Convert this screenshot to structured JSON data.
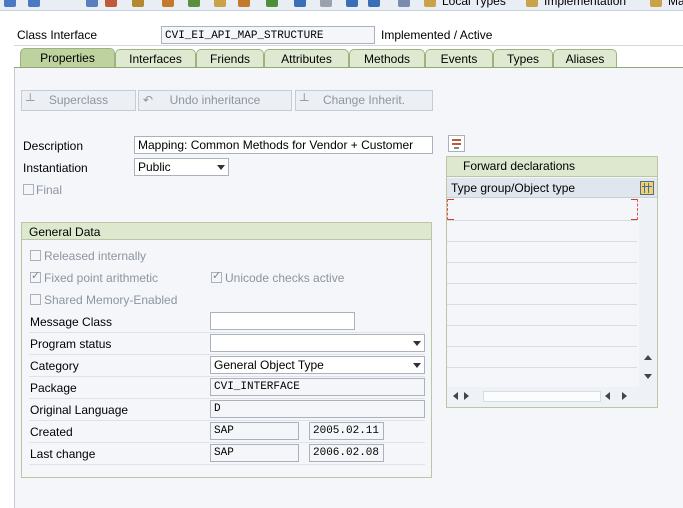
{
  "toolbar": {
    "local_types_label": "Local Types",
    "implementation_label": "Implementation",
    "macros_label": "Ma"
  },
  "header": {
    "class_interface_label": "Class Interface",
    "class_interface_value": "CVI_EI_API_MAP_STRUCTURE",
    "status": "Implemented / Active"
  },
  "tabs": [
    {
      "label": "Properties",
      "active": true
    },
    {
      "label": "Interfaces"
    },
    {
      "label": "Friends"
    },
    {
      "label": "Attributes"
    },
    {
      "label": "Methods"
    },
    {
      "label": "Events"
    },
    {
      "label": "Types"
    },
    {
      "label": "Aliases"
    }
  ],
  "buttons": {
    "superclass": "Superclass",
    "undo_inheritance": "Undo inheritance",
    "change_inherit": "Change Inherit."
  },
  "properties": {
    "description_label": "Description",
    "description_value": "Mapping: Common Methods for Vendor + Customer",
    "instantiation_label": "Instantiation",
    "instantiation_value": "Public",
    "final_label": "Final"
  },
  "general_data": {
    "title": "General Data",
    "released_internally": "Released internally",
    "fixed_point": "Fixed point arithmetic",
    "unicode_checks": "Unicode checks active",
    "shared_memory": "Shared Memory-Enabled",
    "message_class_label": "Message Class",
    "message_class_value": "",
    "program_status_label": "Program status",
    "program_status_value": "",
    "category_label": "Category",
    "category_value": "General Object Type",
    "package_label": "Package",
    "package_value": "CVI_INTERFACE",
    "original_language_label": "Original Language",
    "original_language_value": "D",
    "created_label": "Created",
    "created_by": "SAP",
    "created_on": "2005.02.11",
    "last_change_label": "Last change",
    "last_change_by": "SAP",
    "last_change_on": "2006.02.08"
  },
  "forward": {
    "title": "Forward declarations",
    "column": "Type group/Object type"
  }
}
